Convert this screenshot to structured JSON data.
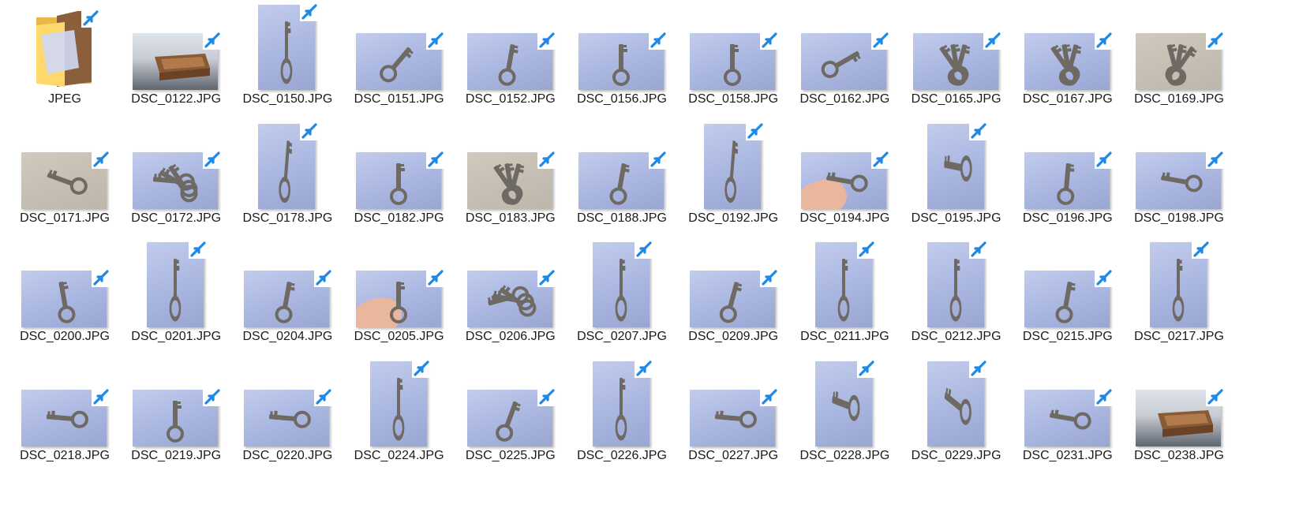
{
  "window": {
    "view": "Large icons"
  },
  "colors": {
    "background": "#ffffff",
    "badge": "#1e88e5",
    "thumb_bg": "#aeb9e3",
    "key_metal": "#6e6a63"
  },
  "items": [
    {
      "name": "JPEG",
      "type": "folder-shortcut",
      "icon": "folder-icon"
    },
    {
      "name": "DSC_0122.JPG",
      "type": "image-shortcut",
      "icon": "drawer-photo"
    },
    {
      "name": "DSC_0150.JPG",
      "type": "image-shortcut",
      "icon": "key-photo"
    },
    {
      "name": "DSC_0151.JPG",
      "type": "image-shortcut",
      "icon": "key-photo"
    },
    {
      "name": "DSC_0152.JPG",
      "type": "image-shortcut",
      "icon": "key-photo"
    },
    {
      "name": "DSC_0156.JPG",
      "type": "image-shortcut",
      "icon": "key-photo"
    },
    {
      "name": "DSC_0158.JPG",
      "type": "image-shortcut",
      "icon": "key-photo"
    },
    {
      "name": "DSC_0162.JPG",
      "type": "image-shortcut",
      "icon": "key-photo"
    },
    {
      "name": "DSC_0165.JPG",
      "type": "image-shortcut",
      "icon": "keys-photo"
    },
    {
      "name": "DSC_0167.JPG",
      "type": "image-shortcut",
      "icon": "keys-photo"
    },
    {
      "name": "DSC_0169.JPG",
      "type": "image-shortcut",
      "icon": "keys-photo"
    },
    {
      "name": "DSC_0171.JPG",
      "type": "image-shortcut",
      "icon": "key-photo"
    },
    {
      "name": "DSC_0172.JPG",
      "type": "image-shortcut",
      "icon": "keys-photo"
    },
    {
      "name": "DSC_0178.JPG",
      "type": "image-shortcut",
      "icon": "key-photo"
    },
    {
      "name": "DSC_0182.JPG",
      "type": "image-shortcut",
      "icon": "key-photo"
    },
    {
      "name": "DSC_0183.JPG",
      "type": "image-shortcut",
      "icon": "keys-photo"
    },
    {
      "name": "DSC_0188.JPG",
      "type": "image-shortcut",
      "icon": "key-photo"
    },
    {
      "name": "DSC_0192.JPG",
      "type": "image-shortcut",
      "icon": "key-photo"
    },
    {
      "name": "DSC_0194.JPG",
      "type": "image-shortcut",
      "icon": "key-in-hand-photo"
    },
    {
      "name": "DSC_0195.JPG",
      "type": "image-shortcut",
      "icon": "key-photo"
    },
    {
      "name": "DSC_0196.JPG",
      "type": "image-shortcut",
      "icon": "key-photo"
    },
    {
      "name": "DSC_0198.JPG",
      "type": "image-shortcut",
      "icon": "key-photo"
    },
    {
      "name": "DSC_0200.JPG",
      "type": "image-shortcut",
      "icon": "key-photo"
    },
    {
      "name": "DSC_0201.JPG",
      "type": "image-shortcut",
      "icon": "key-photo"
    },
    {
      "name": "DSC_0204.JPG",
      "type": "image-shortcut",
      "icon": "key-photo"
    },
    {
      "name": "DSC_0205.JPG",
      "type": "image-shortcut",
      "icon": "key-in-hand-photo"
    },
    {
      "name": "DSC_0206.JPG",
      "type": "image-shortcut",
      "icon": "keys-photo"
    },
    {
      "name": "DSC_0207.JPG",
      "type": "image-shortcut",
      "icon": "key-photo"
    },
    {
      "name": "DSC_0209.JPG",
      "type": "image-shortcut",
      "icon": "key-photo"
    },
    {
      "name": "DSC_0211.JPG",
      "type": "image-shortcut",
      "icon": "key-photo"
    },
    {
      "name": "DSC_0212.JPG",
      "type": "image-shortcut",
      "icon": "key-photo"
    },
    {
      "name": "DSC_0215.JPG",
      "type": "image-shortcut",
      "icon": "key-photo"
    },
    {
      "name": "DSC_0217.JPG",
      "type": "image-shortcut",
      "icon": "key-photo"
    },
    {
      "name": "DSC_0218.JPG",
      "type": "image-shortcut",
      "icon": "key-photo"
    },
    {
      "name": "DSC_0219.JPG",
      "type": "image-shortcut",
      "icon": "key-photo"
    },
    {
      "name": "DSC_0220.JPG",
      "type": "image-shortcut",
      "icon": "key-photo"
    },
    {
      "name": "DSC_0224.JPG",
      "type": "image-shortcut",
      "icon": "key-photo"
    },
    {
      "name": "DSC_0225.JPG",
      "type": "image-shortcut",
      "icon": "key-photo"
    },
    {
      "name": "DSC_0226.JPG",
      "type": "image-shortcut",
      "icon": "key-photo"
    },
    {
      "name": "DSC_0227.JPG",
      "type": "image-shortcut",
      "icon": "key-photo"
    },
    {
      "name": "DSC_0228.JPG",
      "type": "image-shortcut",
      "icon": "key-photo"
    },
    {
      "name": "DSC_0229.JPG",
      "type": "image-shortcut",
      "icon": "key-photo"
    },
    {
      "name": "DSC_0231.JPG",
      "type": "image-shortcut",
      "icon": "key-photo"
    },
    {
      "name": "DSC_0238.JPG",
      "type": "image-shortcut",
      "icon": "drawer-photo"
    }
  ]
}
